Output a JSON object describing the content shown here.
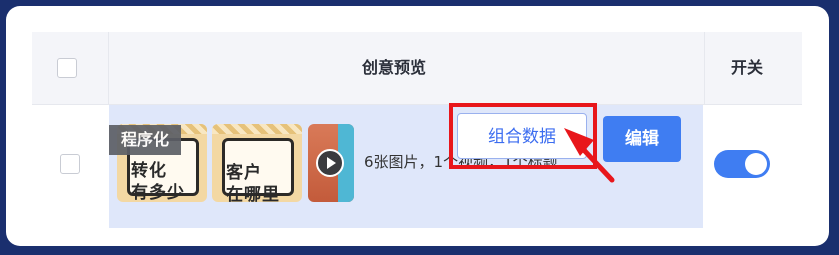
{
  "table": {
    "header": {
      "preview": "创意预览",
      "switch": "开关"
    },
    "row": {
      "tag": "程序化",
      "thumbs": [
        {
          "line1": "转化",
          "line2": "有多少"
        },
        {
          "line1": "客户",
          "line2": "在哪里"
        }
      ],
      "description": "6张图片，1个视频，1个标题",
      "combine_button": "组合数据",
      "edit_button": "编辑",
      "toggle_on": true
    }
  },
  "annotation": {
    "highlight_color": "#e8161b"
  },
  "colors": {
    "accent": "#3f7df2",
    "selected_row": "#dfe7fa",
    "frame": "#1a2f6e"
  }
}
